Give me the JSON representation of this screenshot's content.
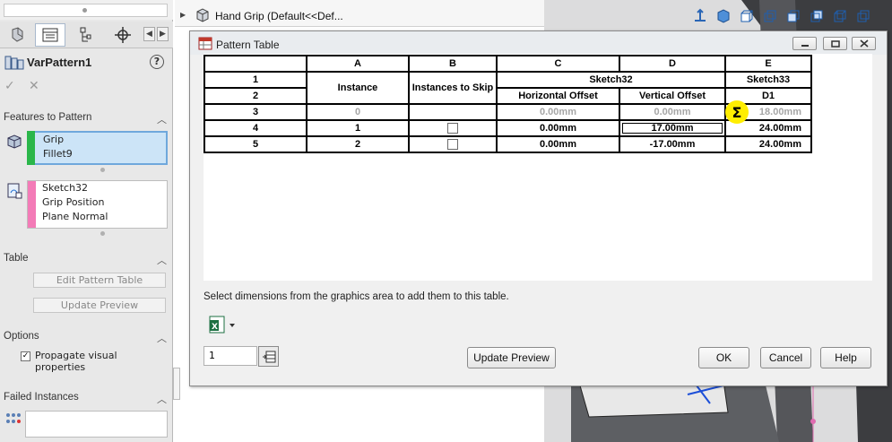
{
  "topbar": {
    "document_title": "Hand Grip  (Default<<Def..."
  },
  "property_manager": {
    "feature_name": "VarPattern1",
    "features_section": {
      "title": "Features to Pattern",
      "items": [
        "Grip",
        "Fillet9"
      ]
    },
    "driving_list": [
      "Sketch32",
      "Grip Position",
      "Plane Normal"
    ],
    "table_section": {
      "title": "Table",
      "edit_button": "Edit Pattern Table",
      "update_button": "Update Preview"
    },
    "options_section": {
      "title": "Options",
      "propagate_label": "Propagate visual properties",
      "propagate_checked": true
    },
    "failed_section": {
      "title": "Failed Instances"
    }
  },
  "dialog": {
    "title": "Pattern Table",
    "col_letters": [
      "A",
      "B",
      "C",
      "D",
      "E"
    ],
    "headers": {
      "instance": "Instance",
      "instances_to_skip": "Instances to Skip",
      "sketch32": "Sketch32",
      "sketch33": "Sketch33",
      "horizontal_offset": "Horizontal Offset",
      "vertical_offset": "Vertical Offset",
      "d1": "D1"
    },
    "row_numbers": [
      "1",
      "2",
      "3",
      "4",
      "5"
    ],
    "rows": [
      {
        "instance": "0",
        "horizontal": "0.00mm",
        "vertical": "0.00mm",
        "d1": "18.00mm"
      },
      {
        "instance": "1",
        "horizontal": "0.00mm",
        "vertical": "17.00mm",
        "d1": "24.00mm"
      },
      {
        "instance": "2",
        "horizontal": "0.00mm",
        "vertical": "-17.00mm",
        "d1": "24.00mm"
      }
    ],
    "sigma": "Σ",
    "help_text": "Select dimensions from the graphics area to add them to this table.",
    "spin_value": "1",
    "buttons": {
      "update_preview": "Update Preview",
      "ok": "OK",
      "cancel": "Cancel",
      "help": "Help"
    }
  },
  "colors": {
    "selection_fill": "#cce4f7",
    "features_bar": "#2ab64a",
    "driving_bar": "#f37bb7",
    "highlight": "#ffee00"
  }
}
